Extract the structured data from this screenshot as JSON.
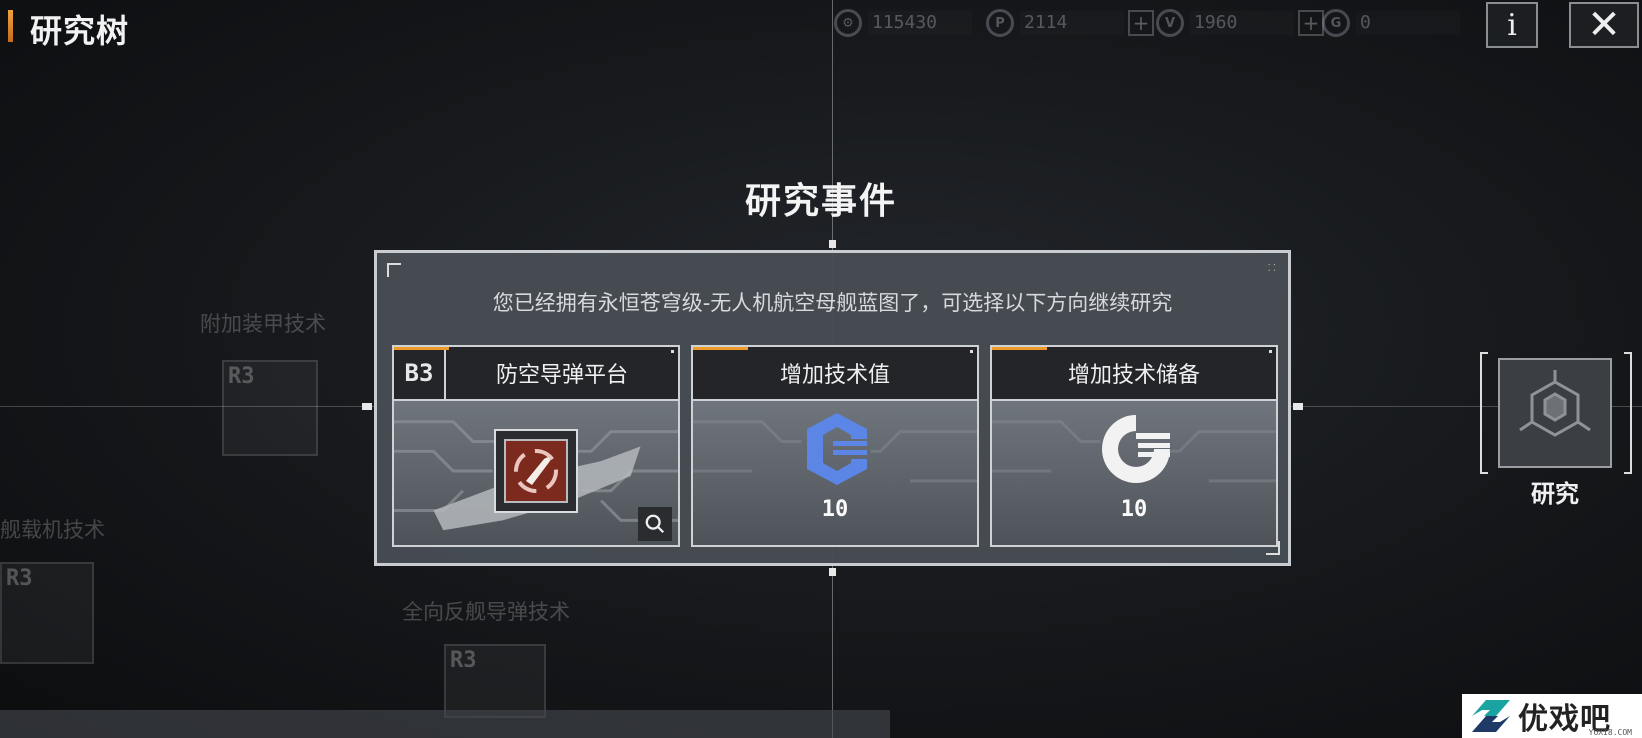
{
  "header": {
    "title": "研究树",
    "currencies": [
      {
        "icon": "gear-coin-icon",
        "value": "115430",
        "has_plus": false
      },
      {
        "icon": "p-coin-icon",
        "value": "2114",
        "has_plus": true
      },
      {
        "icon": "v-coin-icon",
        "value": "1960",
        "has_plus": true
      },
      {
        "icon": "tech-reserve-icon",
        "value": "0",
        "has_plus": false
      }
    ],
    "info_label": "i",
    "close_label": "✕"
  },
  "background_tree": {
    "labels": [
      "附加装甲技术",
      "舰载机技术",
      "全向反舰导弹技术"
    ],
    "node_codes": [
      "R3",
      "R3",
      "R3"
    ]
  },
  "event": {
    "heading": "研究事件",
    "description": "您已经拥有永恒苍穹级-无人机航空母舰蓝图了，可选择以下方向继续研究",
    "options": [
      {
        "badge": "B3",
        "title": "防空导弹平台",
        "icon": "bullet-target-icon"
      },
      {
        "title": "增加技术值",
        "icon": "tech-value-icon",
        "value": "10"
      },
      {
        "title": "增加技术储备",
        "icon": "tech-reserve-icon",
        "value": "10"
      }
    ]
  },
  "research_node": {
    "label": "研究",
    "icon": "hexagon-network-icon"
  },
  "watermark": {
    "text": "优戏吧",
    "sub": "YOXI8.COM"
  },
  "colors": {
    "accent": "#f09a2a",
    "modal_bg": "#484d54",
    "card_header": "#232528",
    "tech_blue": "#5b86e5",
    "weapon_red": "#7c2a1d"
  }
}
